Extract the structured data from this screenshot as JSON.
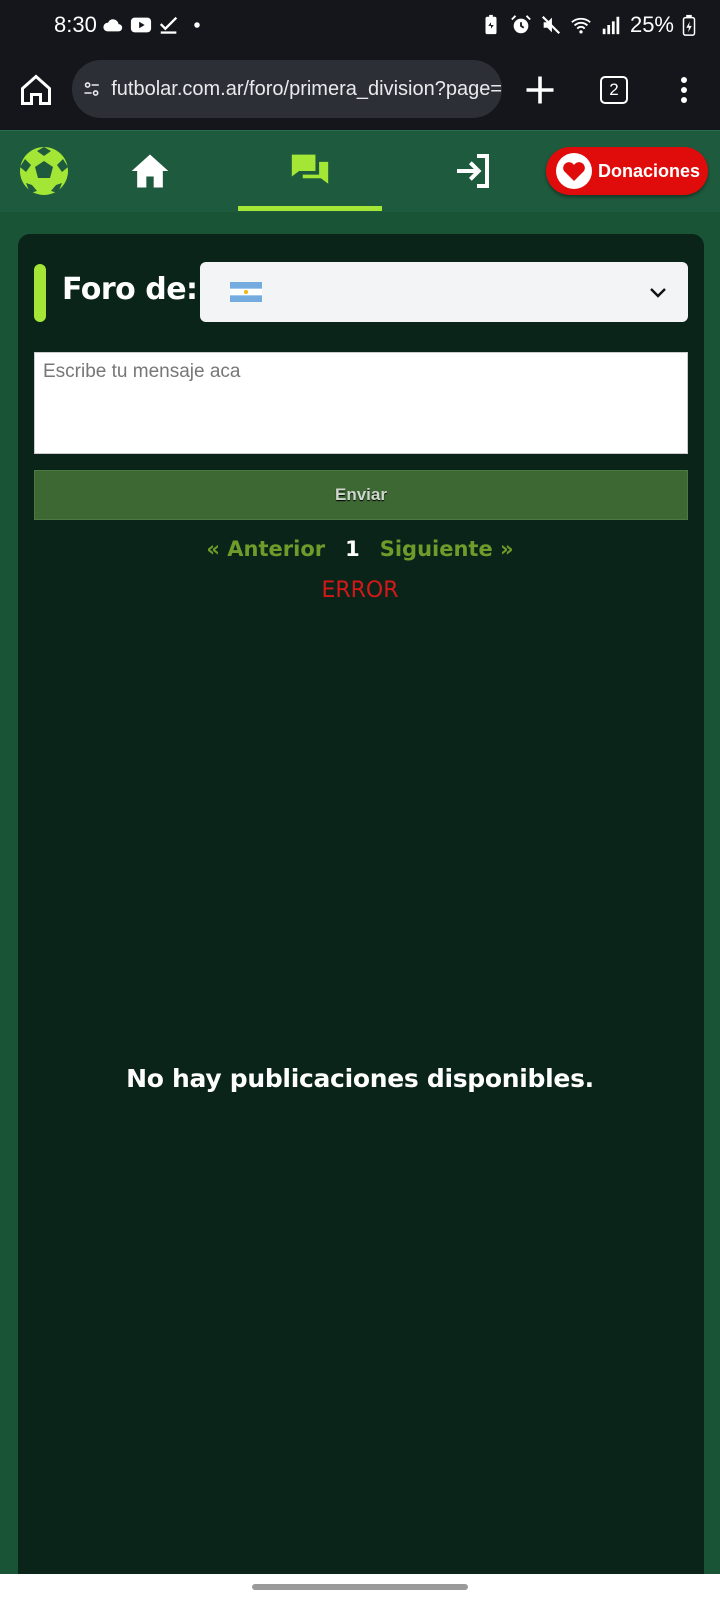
{
  "status_bar": {
    "time": "8:30",
    "battery": "25%"
  },
  "browser": {
    "url": "futbolar.com.ar/foro/primera_division?page=",
    "tab_count": "2"
  },
  "header": {
    "donate_label": "Donaciones",
    "active_tab": "foro",
    "accent_color": "#a3e635",
    "donate_color": "#e00c0c"
  },
  "forum": {
    "label": "Foro de:",
    "selected_country": "argentina-flag",
    "message_placeholder": "Escribe tu mensaje aca",
    "send_label": "Enviar",
    "prev_label": "« Anterior",
    "current_page": "1",
    "next_label": "Siguiente »",
    "error_text": "ERROR",
    "empty_text": "No hay publicaciones disponibles."
  }
}
